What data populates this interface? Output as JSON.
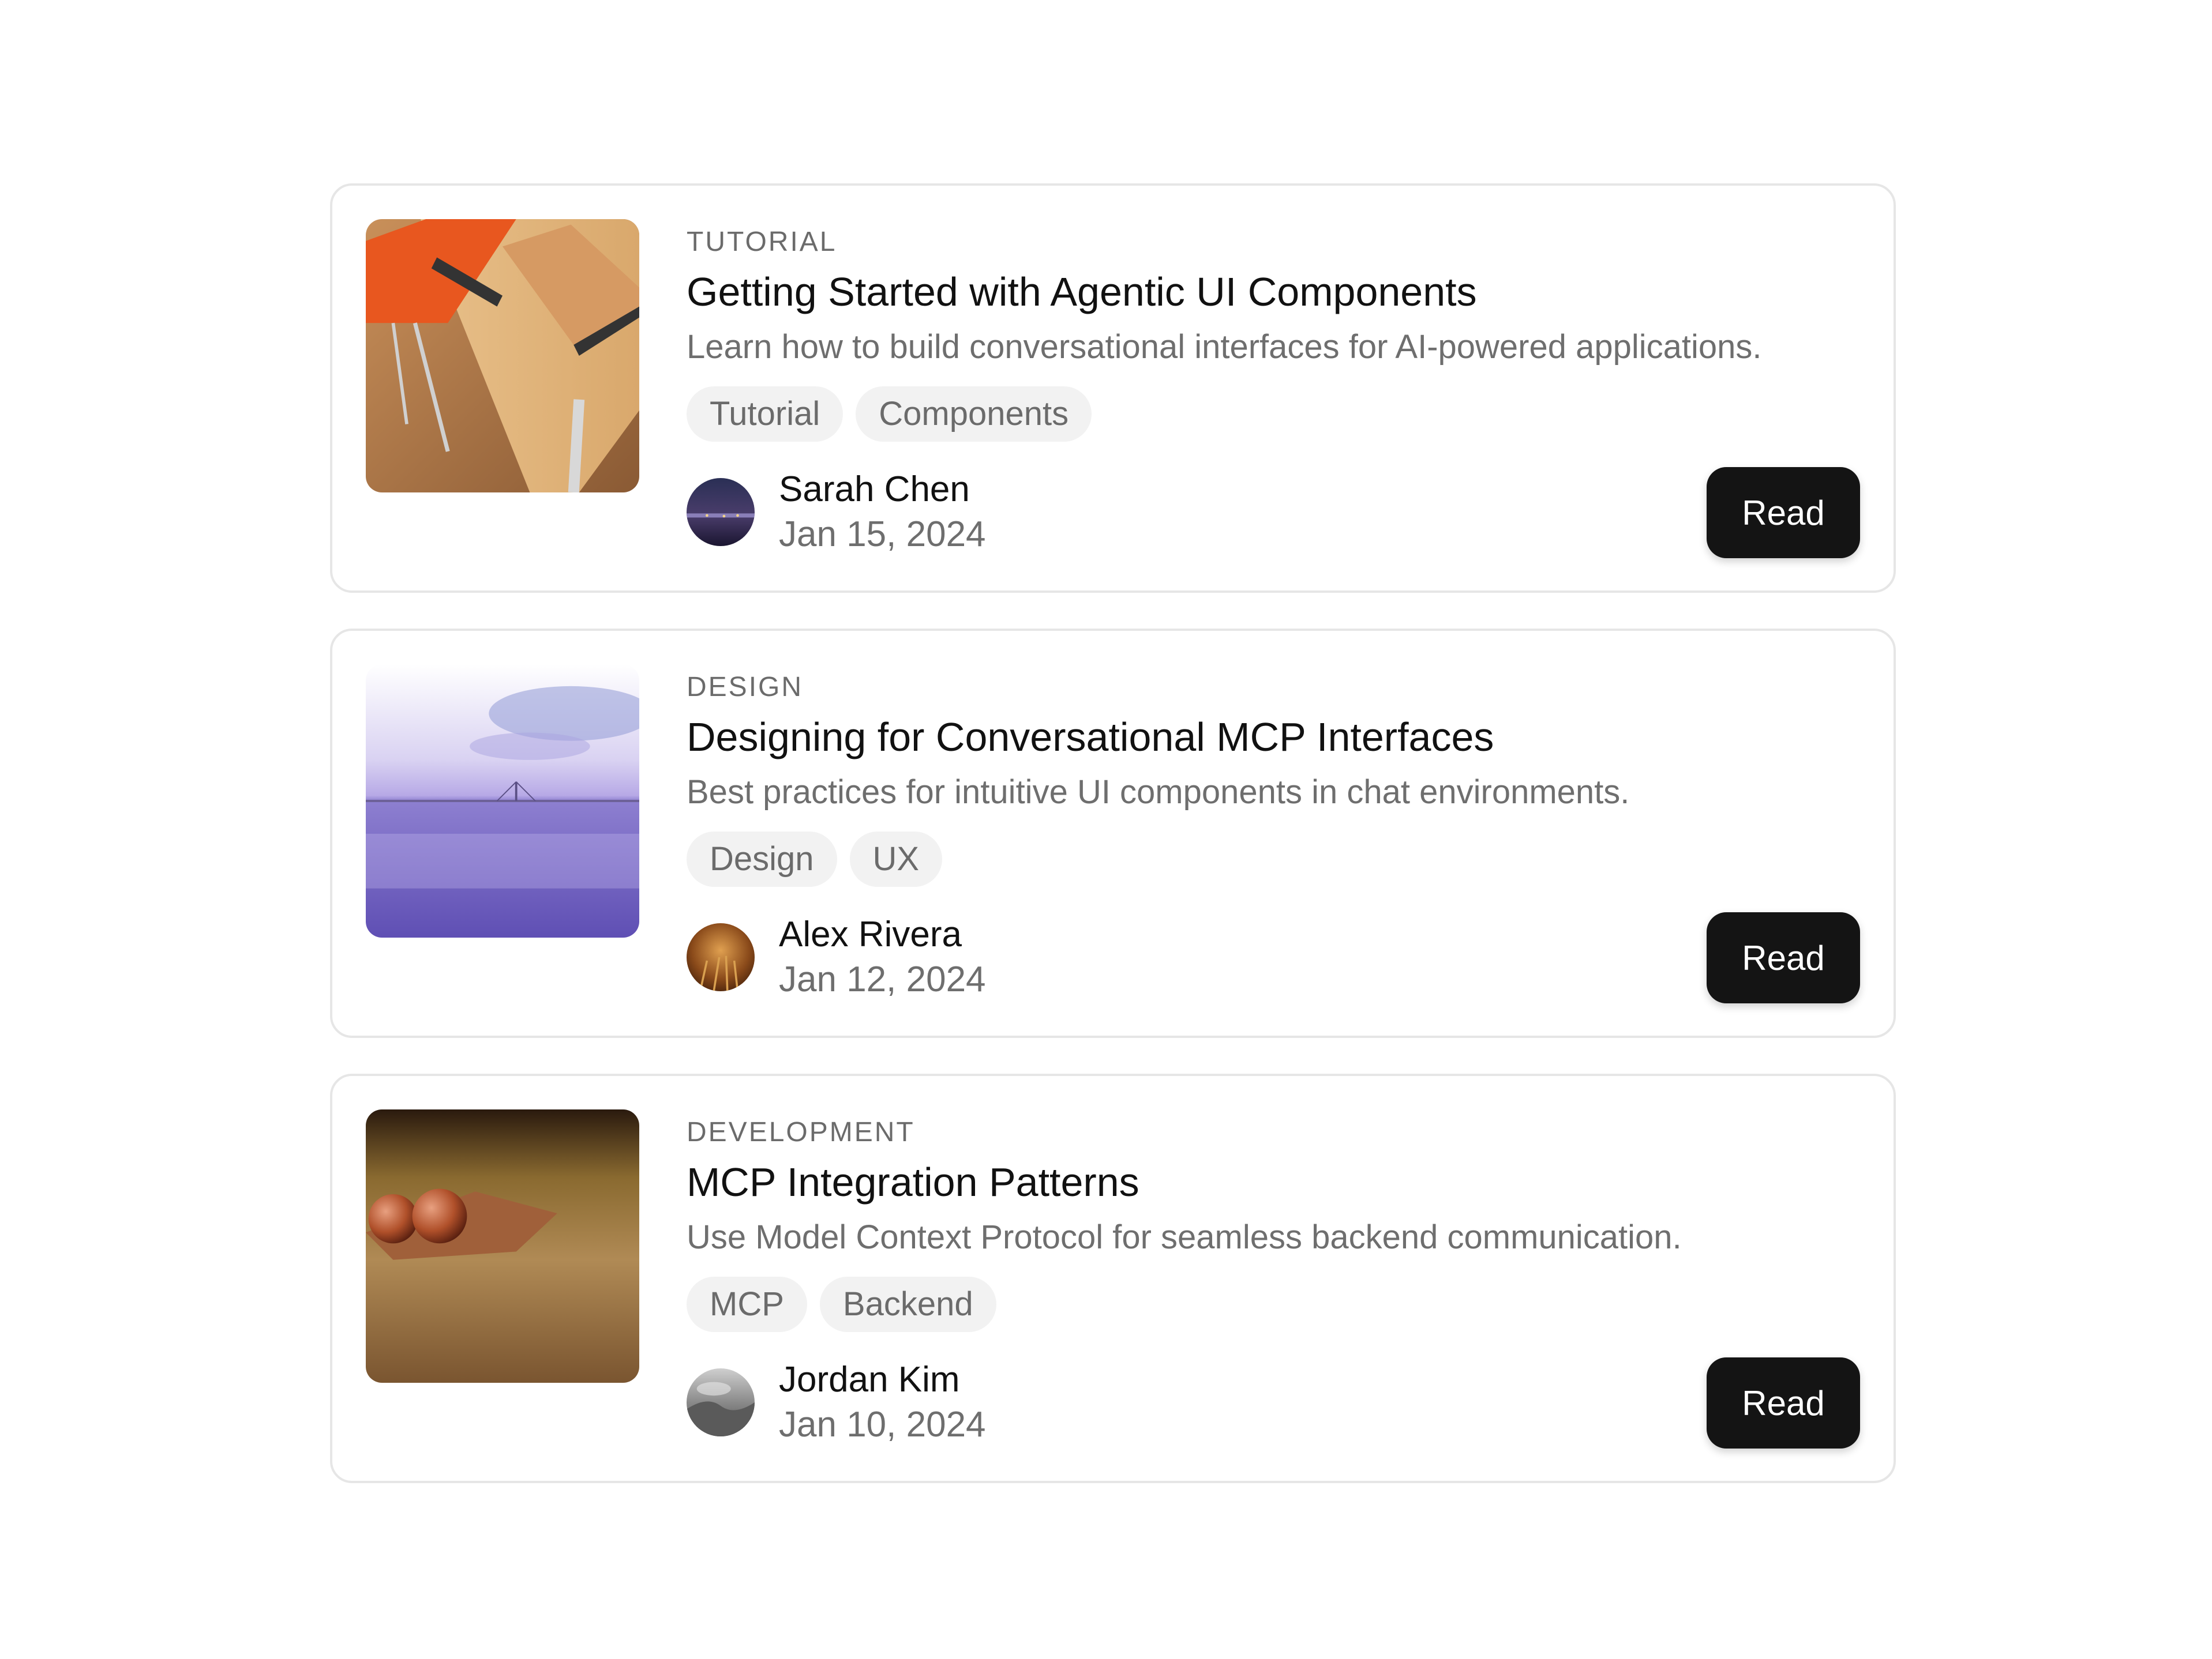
{
  "articles": [
    {
      "image_icon": "desk-notebook-chair-photo",
      "category": "TUTORIAL",
      "title": "Getting Started with Agentic UI Components",
      "description": "Learn how to build conversational interfaces for AI-powered applications.",
      "tags": [
        "Tutorial",
        "Components"
      ],
      "author": "Sarah Chen",
      "date": "Jan 15, 2024",
      "avatar_icon": "night-city-avatar",
      "button_label": "Read"
    },
    {
      "image_icon": "purple-sea-bridge-photo",
      "category": "DESIGN",
      "title": "Designing for Conversational MCP Interfaces",
      "description": "Best practices for intuitive UI components in chat environments.",
      "tags": [
        "Design",
        "UX"
      ],
      "author": "Alex Rivera",
      "date": "Jan 12, 2024",
      "avatar_icon": "golden-field-avatar",
      "button_label": "Read"
    },
    {
      "image_icon": "berries-on-leaf-photo",
      "category": "DEVELOPMENT",
      "title": "MCP Integration Patterns",
      "description": "Use Model Context Protocol for seamless backend communication.",
      "tags": [
        "MCP",
        "Backend"
      ],
      "author": "Jordan Kim",
      "date": "Jan 10, 2024",
      "avatar_icon": "mono-landscape-avatar",
      "button_label": "Read"
    }
  ],
  "colors": {
    "button_bg": "#141414",
    "tag_bg": "#f2f2f2",
    "border": "#e6e6e6",
    "muted_text": "#6e6e6e"
  }
}
